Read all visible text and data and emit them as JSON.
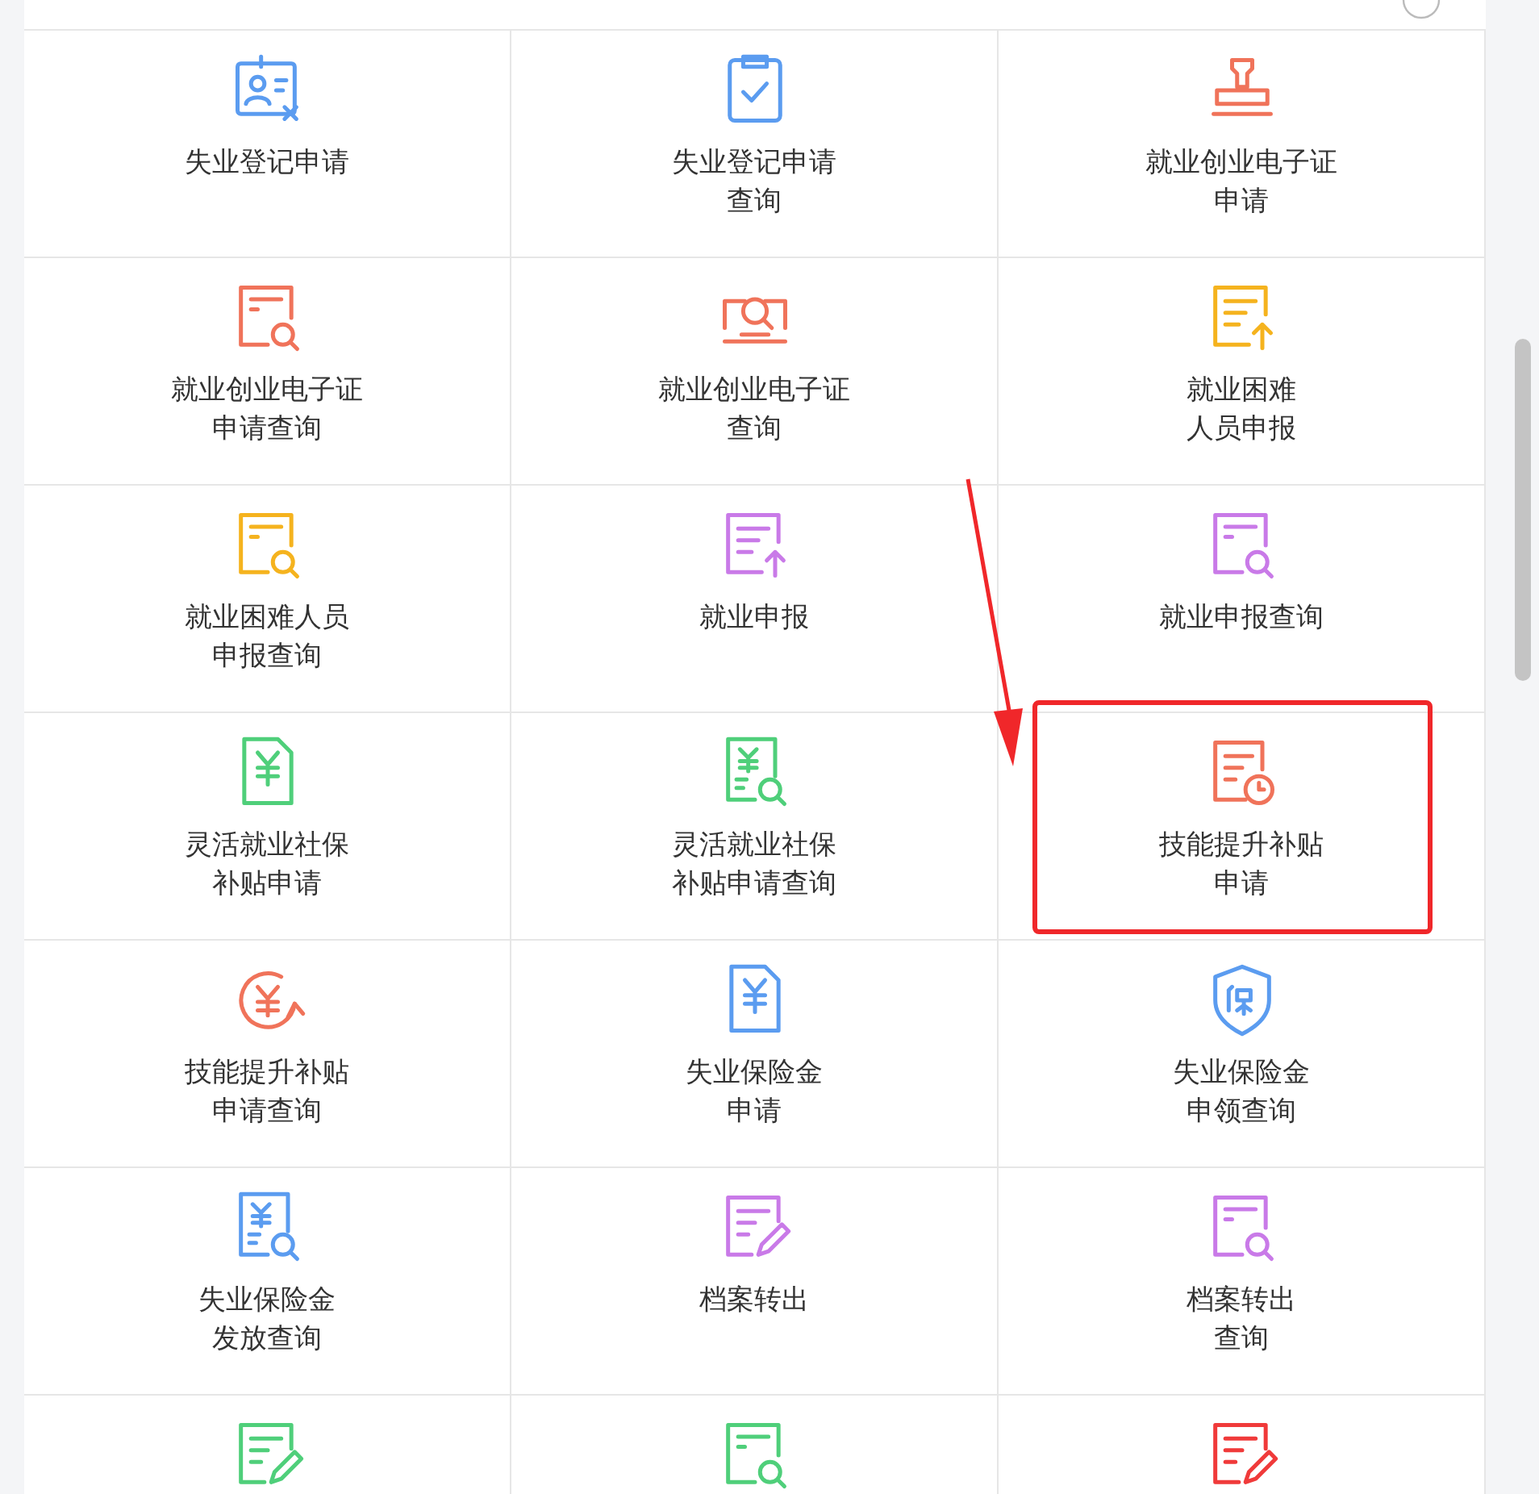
{
  "tiles": [
    {
      "kind": "id-card",
      "color": "#5b9cf0",
      "lines": [
        "失业登记申请"
      ],
      "highlighted": false
    },
    {
      "kind": "clipboard-check",
      "color": "#5b9cf0",
      "lines": [
        "失业登记申请",
        "查询"
      ],
      "highlighted": false
    },
    {
      "kind": "stamp",
      "color": "#f0735a",
      "lines": [
        "就业创业电子证",
        "申请"
      ],
      "highlighted": false
    },
    {
      "kind": "doc-search",
      "color": "#f0735a",
      "lines": [
        "就业创业电子证",
        "申请查询"
      ],
      "highlighted": false
    },
    {
      "kind": "card-search",
      "color": "#f0735a",
      "lines": [
        "就业创业电子证",
        "查询"
      ],
      "highlighted": false
    },
    {
      "kind": "doc-upload",
      "color": "#f5b31e",
      "lines": [
        "就业困难",
        "人员申报"
      ],
      "highlighted": false
    },
    {
      "kind": "doc-search",
      "color": "#f5b31e",
      "lines": [
        "就业困难人员",
        "申报查询"
      ],
      "highlighted": false
    },
    {
      "kind": "doc-upload",
      "color": "#c97ae8",
      "lines": [
        "就业申报"
      ],
      "highlighted": false
    },
    {
      "kind": "doc-search",
      "color": "#c97ae8",
      "lines": [
        "就业申报查询"
      ],
      "highlighted": false
    },
    {
      "kind": "doc-yen",
      "color": "#4fcf7a",
      "lines": [
        "灵活就业社保",
        "补贴申请"
      ],
      "highlighted": false
    },
    {
      "kind": "doc-yen-search",
      "color": "#4fcf7a",
      "lines": [
        "灵活就业社保",
        "补贴申请查询"
      ],
      "highlighted": false
    },
    {
      "kind": "doc-clock",
      "color": "#f0735a",
      "lines": [
        "技能提升补贴",
        "申请"
      ],
      "highlighted": true
    },
    {
      "kind": "yen-cycle",
      "color": "#f0735a",
      "lines": [
        "技能提升补贴",
        "申请查询"
      ],
      "highlighted": false
    },
    {
      "kind": "doc-yen",
      "color": "#5b9cf0",
      "lines": [
        "失业保险金",
        "申请"
      ],
      "highlighted": false
    },
    {
      "kind": "shield",
      "color": "#5b9cf0",
      "lines": [
        "失业保险金",
        "申领查询"
      ],
      "highlighted": false
    },
    {
      "kind": "doc-yen-search",
      "color": "#5b9cf0",
      "lines": [
        "失业保险金",
        "发放查询"
      ],
      "highlighted": false
    },
    {
      "kind": "doc-pen",
      "color": "#c97ae8",
      "lines": [
        "档案转出"
      ],
      "highlighted": false
    },
    {
      "kind": "doc-search",
      "color": "#c97ae8",
      "lines": [
        "档案转出",
        "查询"
      ],
      "highlighted": false
    },
    {
      "kind": "doc-pen",
      "color": "#4fcf7a",
      "highlighted": false
    },
    {
      "kind": "doc-search",
      "color": "#4fcf7a",
      "highlighted": false
    },
    {
      "kind": "doc-pen",
      "color": "#f03a3a",
      "highlighted": false
    }
  ]
}
